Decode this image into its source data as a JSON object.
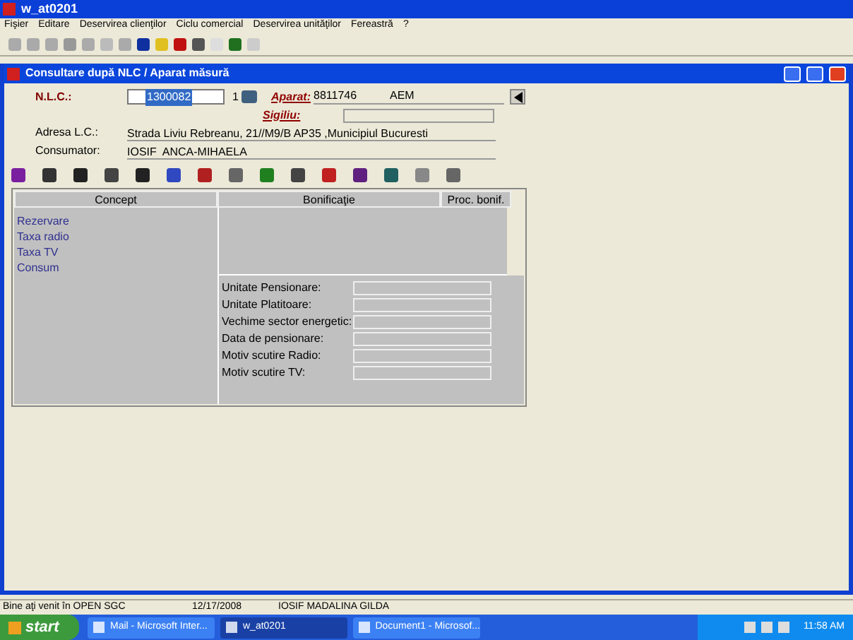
{
  "window": {
    "title": "w_at0201"
  },
  "menu": [
    "Fişier",
    "Editare",
    "Deservirea clienţilor",
    "Ciclu comercial",
    "Deservirea unităţilor",
    "Fereastră",
    "?"
  ],
  "child_window": {
    "title": "Consultare după NLC / Aparat măsură"
  },
  "form": {
    "nlc_label": "N.L.C.:",
    "nlc_value": "1300082",
    "nlc_suffix": "1",
    "aparat_label": "Aparat:",
    "aparat_value": "8811746",
    "aparat_type": "AEM",
    "sigiliu_label": "Sigiliu:",
    "adresa_label": "Adresa L.C.:",
    "adresa_value": "Strada Liviu Rebreanu, 21//M9/B AP35 ,Municipiul Bucuresti",
    "consumator_label": "Consumator:",
    "consumator_value": "IOSIF  ANCA-MIHAELA"
  },
  "table": {
    "columns": [
      "Concept",
      "Bonificaţie",
      "Proc. bonif."
    ],
    "rows": [
      "Rezervare",
      "Taxa radio",
      "Taxa TV",
      "Consum"
    ]
  },
  "details": [
    "Unitate Pensionare:",
    "Unitate Platitoare:",
    "Vechime sector energetic:",
    "Data de pensionare:",
    "Motiv scutire Radio:",
    "Motiv scutire TV:"
  ],
  "status_bar": [
    "Bine aţi venit în OPEN SGC",
    "12/17/2008",
    "IOSIF MADALINA GILDA"
  ],
  "taskbar": {
    "start": "start",
    "tasks": [
      {
        "label": "Mail - Microsoft Inter...",
        "selected": false
      },
      {
        "label": "w_at0201",
        "selected": true
      },
      {
        "label": "Document1 - Microsof...",
        "selected": false
      }
    ],
    "clock": "11:58 AM"
  }
}
